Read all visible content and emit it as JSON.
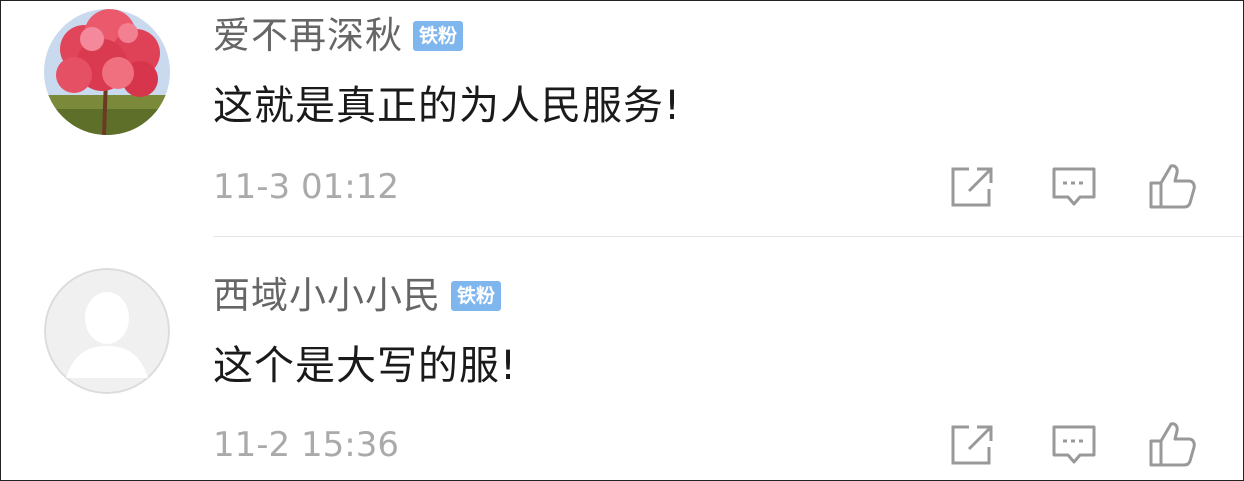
{
  "comments": [
    {
      "username": "爱不再深秋",
      "badge": "铁粉",
      "text": "这就是真正的为人民服务!",
      "timestamp": "11-3 01:12",
      "avatar": "red-tree-photo"
    },
    {
      "username": "西域小小小民",
      "badge": "铁粉",
      "text": "这个是大写的服!",
      "timestamp": "11-2 15:36",
      "avatar": "default-user-silhouette"
    }
  ],
  "colors": {
    "badge_bg": "#7fb6ee",
    "username": "#666666",
    "timestamp": "#aaaaaa",
    "icon": "#999999"
  },
  "icons": [
    "share-icon",
    "reply-icon",
    "like-icon"
  ]
}
